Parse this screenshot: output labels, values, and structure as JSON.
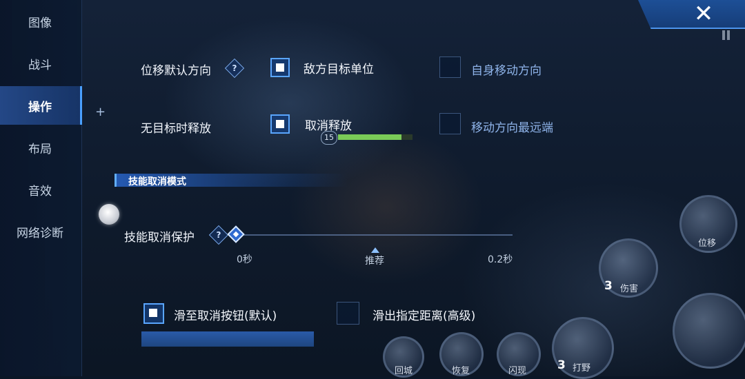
{
  "sidebar": {
    "items": [
      {
        "label": "图像",
        "active": false
      },
      {
        "label": "战斗",
        "active": false
      },
      {
        "label": "操作",
        "active": true
      },
      {
        "label": "布局",
        "active": false
      },
      {
        "label": "音效",
        "active": false
      },
      {
        "label": "网络诊断",
        "active": false
      }
    ]
  },
  "close_icon": "✕",
  "settings": {
    "displacement_direction": {
      "label": "位移默认方向",
      "help": "?",
      "options": [
        {
          "label": "敌方目标单位",
          "checked": true
        },
        {
          "label": "自身移动方向",
          "checked": false
        }
      ]
    },
    "no_target_release": {
      "label": "无目标时释放",
      "options": [
        {
          "label": "取消释放",
          "checked": true
        },
        {
          "label": "移动方向最远端",
          "checked": false
        }
      ]
    },
    "cancel_mode_section": {
      "title": "技能取消模式",
      "protection": {
        "label": "技能取消保护",
        "help": "?",
        "value_fraction": 0,
        "ticks": {
          "min": "0秒",
          "mid": "推荐",
          "max": "0.2秒"
        }
      },
      "options": [
        {
          "label": "滑至取消按钮(默认)",
          "checked": true
        },
        {
          "label": "滑出指定距离(高级)",
          "checked": false
        }
      ]
    }
  },
  "hud": {
    "hero_level": "15",
    "hp_fraction": 0.85,
    "skills": [
      {
        "label": "位移",
        "num": ""
      },
      {
        "label": "伤害",
        "num": "3"
      },
      {
        "label": "打野",
        "num": "3"
      },
      {
        "label": "回城",
        "num": ""
      },
      {
        "label": "恢复",
        "num": ""
      },
      {
        "label": "闪现",
        "num": ""
      }
    ]
  },
  "colors": {
    "accent": "#5aa6ff",
    "inactive_text": "#8fb4ea",
    "panel": "#0b1626"
  }
}
